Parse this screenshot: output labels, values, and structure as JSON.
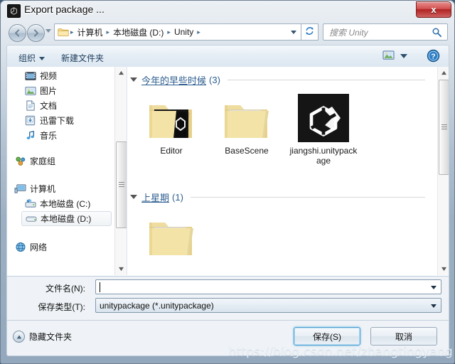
{
  "window": {
    "title": "Export package ...",
    "title_icon": "unity-icon",
    "close_label": "x"
  },
  "nav": {
    "back_icon": "back-arrow-icon",
    "forward_icon": "forward-arrow-icon",
    "history_icon": "chevron-down-icon",
    "refresh_icon": "refresh-icon",
    "folder_icon": "folder-icon",
    "dropdown_icon": "chevron-down-icon",
    "breadcrumbs": [
      "计算机",
      "本地磁盘 (D:)",
      "Unity"
    ],
    "separator": "▸"
  },
  "search": {
    "placeholder": "搜索 Unity",
    "icon": "search-icon"
  },
  "toolbar": {
    "organize_label": "组织",
    "new_folder_label": "新建文件夹",
    "view_icon": "view-thumbnail-icon",
    "view_caret_icon": "chevron-down-icon",
    "help_icon": "help-icon"
  },
  "sidebar": {
    "items": [
      {
        "label": "视频",
        "icon": "video-icon",
        "indent": 1,
        "selected": false
      },
      {
        "label": "图片",
        "icon": "pictures-icon",
        "indent": 1,
        "selected": false
      },
      {
        "label": "文档",
        "icon": "documents-icon",
        "indent": 1,
        "selected": false
      },
      {
        "label": "迅雷下载",
        "icon": "downloads-icon",
        "indent": 1,
        "selected": false
      },
      {
        "label": "音乐",
        "icon": "music-icon",
        "indent": 1,
        "selected": false
      },
      {
        "label": "家庭组",
        "icon": "homegroup-icon",
        "indent": 0,
        "selected": false
      },
      {
        "label": "计算机",
        "icon": "computer-icon",
        "indent": 0,
        "selected": false
      },
      {
        "label": "本地磁盘 (C:)",
        "icon": "system-drive-icon",
        "indent": 1,
        "selected": false
      },
      {
        "label": "本地磁盘 (D:)",
        "icon": "drive-icon",
        "indent": 1,
        "selected": true
      },
      {
        "label": "网络",
        "icon": "network-icon",
        "indent": 0,
        "selected": false
      }
    ]
  },
  "filepane": {
    "groups": [
      {
        "label": "今年的早些时候",
        "count": "(3)",
        "items": [
          {
            "label": "Editor",
            "icon": "folder-unity-icon"
          },
          {
            "label": "BaseScene",
            "icon": "folder-icon"
          },
          {
            "label": "jiangshi.unitypackage",
            "icon": "unitypackage-icon"
          }
        ]
      },
      {
        "label": "上星期",
        "count": "(1)",
        "items": [
          {
            "label": "",
            "icon": "folder-icon"
          }
        ]
      }
    ]
  },
  "form": {
    "filename_label": "文件名(N):",
    "filename_value": "",
    "filetype_label": "保存类型(T):",
    "filetype_value": "unitypackage (*.unitypackage)",
    "caret_icon": "chevron-down-icon"
  },
  "footer": {
    "hide_folders_label": "隐藏文件夹",
    "hide_folders_icon": "chevron-up-circle-icon",
    "save_label": "保存(S)",
    "cancel_label": "取消"
  },
  "watermark": {
    "text": "https://blog.csdn.net/zhangtingyang"
  },
  "colors": {
    "accent_blue": "#4a9fd4",
    "link_blue": "#2c5d8f",
    "close_red": "#b02323",
    "window_glass": "#a9bacb"
  }
}
